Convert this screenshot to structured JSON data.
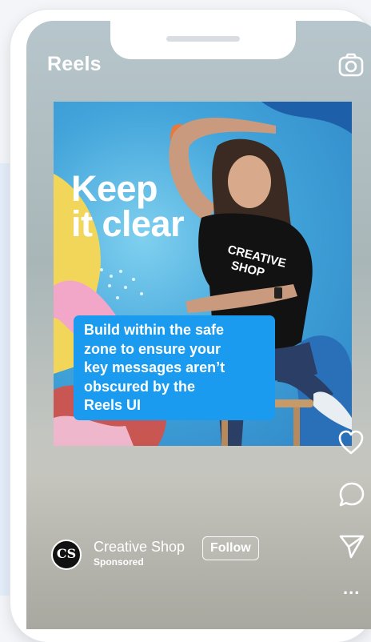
{
  "header": {
    "title": "Reels",
    "camera_icon": "camera-icon"
  },
  "creative": {
    "headline": "Keep\nit clear",
    "callout": "Build within the safe\nzone to ensure your\nkey messages aren’t\nobscured by the\nReels UI",
    "shirt_text": "CREATIVE SHOP"
  },
  "actions": {
    "like_icon": "heart-icon",
    "comment_icon": "comment-icon",
    "share_icon": "send-icon",
    "more_label": "..."
  },
  "account": {
    "avatar_letters": "CS",
    "name": "Creative Shop",
    "sponsored": "Sponsored",
    "follow_label": "Follow"
  },
  "colors": {
    "callout_bg": "#1a9bf0",
    "mural_blue": "#42a4da",
    "text": "#ffffff"
  }
}
